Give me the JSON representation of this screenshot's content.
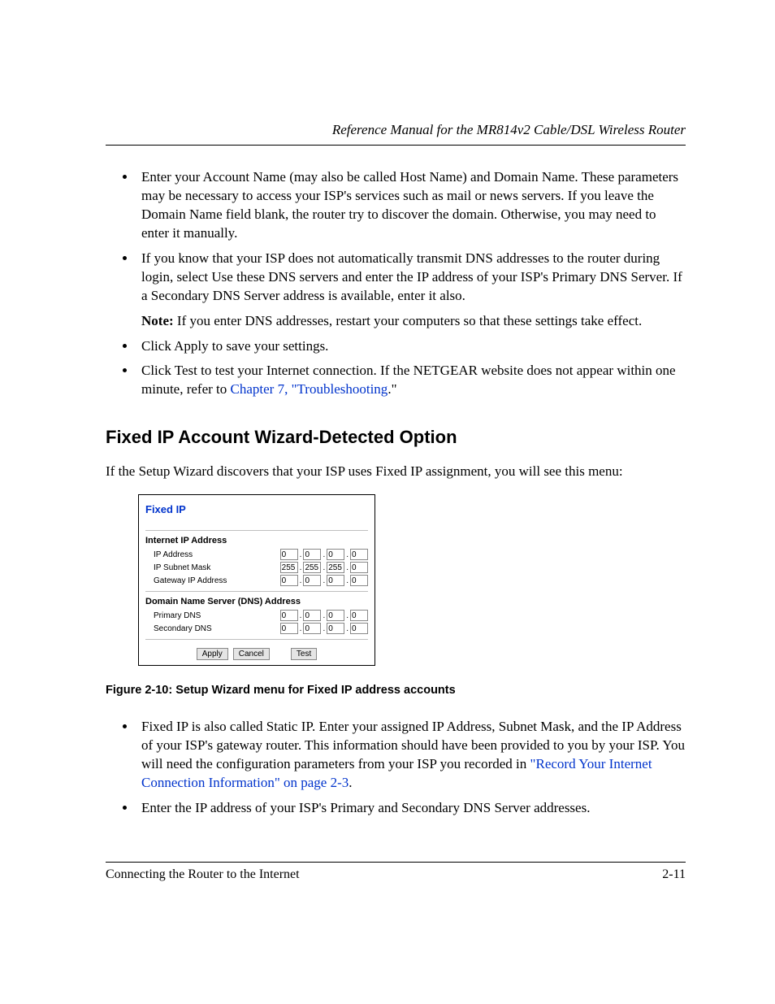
{
  "header": {
    "running": "Reference Manual for the MR814v2 Cable/DSL Wireless Router"
  },
  "bullets_top": [
    {
      "text": "Enter your Account Name (may also be called Host Name) and Domain Name. These parameters may be necessary to access your ISP's services such as mail or news servers. If you leave the Domain Name field blank, the router try to discover the domain. Otherwise, you may need to enter it manually."
    },
    {
      "text": "If you know that your ISP does not automatically transmit DNS addresses to the router during login, select Use these DNS servers and enter the IP address of your ISP's Primary DNS Server. If a Secondary DNS Server address is available, enter it also.",
      "note_label": "Note:",
      "note_text": " If you enter DNS addresses, restart your computers so that these settings take effect."
    },
    {
      "text": "Click Apply to save your settings."
    },
    {
      "pre": "Click Test to test your Internet connection. If the NETGEAR website does not appear within one minute, refer to ",
      "link": "Chapter 7, \"Troubleshooting",
      "post": ".\""
    }
  ],
  "section_heading": "Fixed IP Account Wizard-Detected Option",
  "section_intro": "If the Setup Wizard discovers that your ISP uses Fixed IP assignment, you will see this menu:",
  "panel": {
    "title": "Fixed IP",
    "group1_head": "Internet IP Address",
    "rows1": [
      {
        "label": "IP Address",
        "oct": [
          "0",
          "0",
          "0",
          "0"
        ]
      },
      {
        "label": "IP Subnet Mask",
        "oct": [
          "255",
          "255",
          "255",
          "0"
        ]
      },
      {
        "label": "Gateway IP Address",
        "oct": [
          "0",
          "0",
          "0",
          "0"
        ]
      }
    ],
    "group2_head": "Domain Name Server (DNS) Address",
    "rows2": [
      {
        "label": "Primary DNS",
        "oct": [
          "0",
          "0",
          "0",
          "0"
        ]
      },
      {
        "label": "Secondary DNS",
        "oct": [
          "0",
          "0",
          "0",
          "0"
        ]
      }
    ],
    "buttons": {
      "apply": "Apply",
      "cancel": "Cancel",
      "test": "Test"
    }
  },
  "figure_caption": "Figure 2-10:  Setup Wizard menu for Fixed IP address accounts",
  "bullets_bottom": [
    {
      "pre": "Fixed IP is also called Static IP. Enter your assigned IP Address, Subnet Mask, and the IP Address of your ISP's gateway router. This information should have been provided to you by your ISP. You will need the configuration parameters from your ISP you recorded in ",
      "link": "\"Record Your Internet Connection Information\" on page 2-3",
      "post": "."
    },
    {
      "text": "Enter the IP address of your ISP's Primary and Secondary DNS Server addresses."
    }
  ],
  "footer": {
    "left": "Connecting the Router to the Internet",
    "right": "2-11"
  }
}
